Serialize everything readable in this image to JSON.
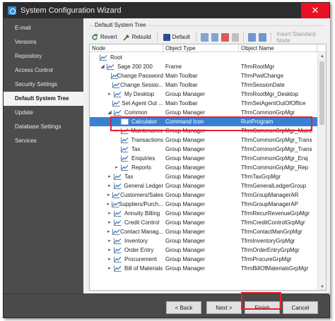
{
  "window": {
    "title": "System Configuration Wizard",
    "close_glyph": "✕"
  },
  "sidebar": {
    "items": [
      {
        "label": "E-mail",
        "active": false
      },
      {
        "label": "Versions",
        "active": false
      },
      {
        "label": "Repository",
        "active": false
      },
      {
        "label": "Access Control",
        "active": false
      },
      {
        "label": "Security Settings",
        "active": false
      },
      {
        "label": "Default System Tree",
        "active": true
      },
      {
        "label": "Update",
        "active": false
      },
      {
        "label": "Database Settings",
        "active": false
      },
      {
        "label": "Services",
        "active": false
      }
    ]
  },
  "panel": {
    "group_label": "Default System Tree"
  },
  "toolbar": {
    "revert_label": "Revert",
    "rebuild_label": "Rebuild",
    "default_label": "Default",
    "insert_standard_node_label": "Insert Standard Node"
  },
  "tree": {
    "columns": [
      "Node",
      "Object Type",
      "Object Name"
    ],
    "rows": [
      {
        "node": "Root",
        "type": "",
        "name": "",
        "level": 0,
        "expander": "",
        "icon": "chart-icon"
      },
      {
        "node": "Sage 200 200",
        "type": "Frame",
        "name": "TfrmRootMgr",
        "level": 1,
        "expander": "◢",
        "icon": "chart-icon"
      },
      {
        "node": "Change Password",
        "type": "Main Toolbar",
        "name": "TfrmPwdChange",
        "level": 2,
        "expander": "",
        "icon": "chart-icon"
      },
      {
        "node": "Change Sessio...",
        "type": "Main Toolbar",
        "name": "TfrmSessionDate",
        "level": 2,
        "expander": "",
        "icon": "chart-icon"
      },
      {
        "node": "My Desktop",
        "type": "Group Manager",
        "name": "TfrmRootMgr_Desktop",
        "level": 2,
        "expander": "▸",
        "icon": "chart-icon"
      },
      {
        "node": "Set Agent Out ...",
        "type": "Main Toolbar",
        "name": "TfrmSetAgentOutOfOffice",
        "level": 2,
        "expander": "",
        "icon": "chart-icon"
      },
      {
        "node": "Common",
        "type": "Group Manager",
        "name": "TfrmCommonGrpMgr",
        "level": 2,
        "expander": "◢",
        "icon": "chart-icon"
      },
      {
        "node": "Calculator",
        "type": "Command Icon",
        "name": "RunProgram",
        "level": 3,
        "expander": "",
        "icon": "blank-icon",
        "selected": true
      },
      {
        "node": "Maintenance",
        "type": "Group Manager",
        "name": "TfrmCommonGrpMgr_Maint",
        "level": 3,
        "expander": "▸",
        "icon": "chart-icon"
      },
      {
        "node": "Transactions",
        "type": "Group Manager",
        "name": "TfrmCommonGrpMgr_Trans",
        "level": 3,
        "expander": "",
        "icon": "chart-icon"
      },
      {
        "node": "Tax",
        "type": "Group Manager",
        "name": "TfrmCommonGrpMgr_Trans",
        "level": 3,
        "expander": "",
        "icon": "chart-icon"
      },
      {
        "node": "Enquiries",
        "type": "Group Manager",
        "name": "TfrmCommonGrpMgr_Enq",
        "level": 3,
        "expander": "",
        "icon": "chart-icon"
      },
      {
        "node": "Reports",
        "type": "Group Manager",
        "name": "TfrmCommonGrpMgr_Rep",
        "level": 3,
        "expander": "▸",
        "icon": "chart-icon"
      },
      {
        "node": "Tax",
        "type": "Group Manager",
        "name": "TfrmTaxGrpMgr",
        "level": 2,
        "expander": "▸",
        "icon": "chart-icon"
      },
      {
        "node": "General Ledger",
        "type": "Group Manager",
        "name": "TfrmGeneralLedgerGroup",
        "level": 2,
        "expander": "▸",
        "icon": "chart-icon"
      },
      {
        "node": "Customers/Sales",
        "type": "Group Manager",
        "name": "TfrmGroupManagerAR",
        "level": 2,
        "expander": "▸",
        "icon": "chart-icon"
      },
      {
        "node": "Suppliers/Purch...",
        "type": "Group Manager",
        "name": "TfrmGroupManagerAP",
        "level": 2,
        "expander": "▸",
        "icon": "chart-icon"
      },
      {
        "node": "Annuity Billing",
        "type": "Group Manager",
        "name": "TfrmRecurRevenueGrpMgr",
        "level": 2,
        "expander": "▸",
        "icon": "chart-icon"
      },
      {
        "node": "Credit Control",
        "type": "Group Manager",
        "name": "TfrmCreditControlGrpMgr",
        "level": 2,
        "expander": "▸",
        "icon": "chart-icon"
      },
      {
        "node": "Contact Manag...",
        "type": "Group Manager",
        "name": "TfrmContactManGrpMgr",
        "level": 2,
        "expander": "▸",
        "icon": "chart-icon"
      },
      {
        "node": "Inventory",
        "type": "Group Manager",
        "name": "TfrmInventoryGrpMgr",
        "level": 2,
        "expander": "▸",
        "icon": "chart-icon"
      },
      {
        "node": "Order Entry",
        "type": "Group Manager",
        "name": "TfrmOrderEntryGrpMgr",
        "level": 2,
        "expander": "▸",
        "icon": "chart-icon"
      },
      {
        "node": "Procurement",
        "type": "Group Manager",
        "name": "TfrmProcureGrpMgr",
        "level": 2,
        "expander": "▸",
        "icon": "chart-icon"
      },
      {
        "node": "Bill of Materials",
        "type": "Group Manager",
        "name": "TfrmBillOfMaterialsGrpMgr",
        "level": 2,
        "expander": "▸",
        "icon": "chart-icon"
      }
    ]
  },
  "footer": {
    "back_label": "< Back",
    "next_label": "Next >",
    "finish_label": "Finish",
    "cancel_label": "Cancel"
  },
  "colors": {
    "accent": "#3a80d2",
    "highlight": "#e8202a",
    "sidebar_bg": "#4c4c4c",
    "titlebar_bg": "#2d2d30"
  }
}
